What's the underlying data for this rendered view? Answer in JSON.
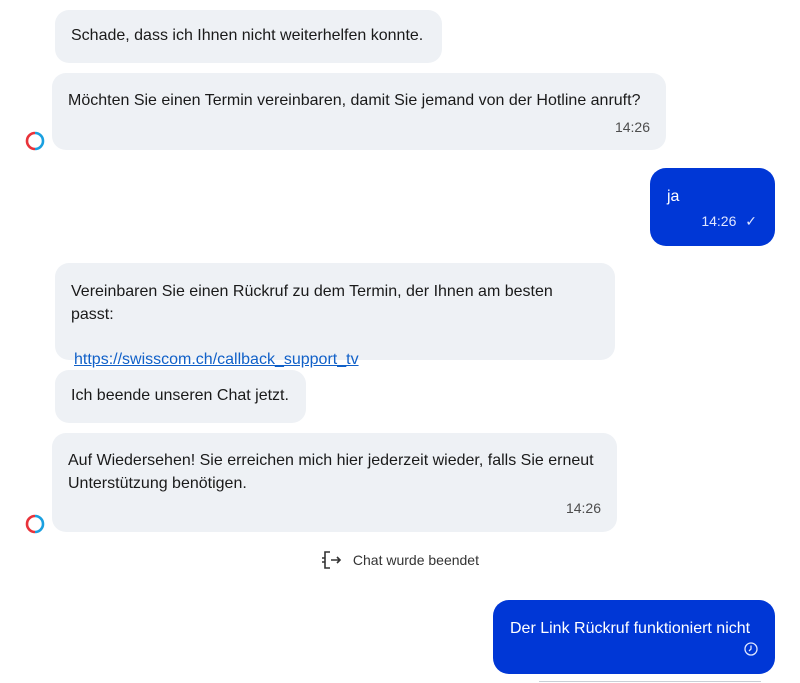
{
  "messages": {
    "m1": {
      "text": "Schade, dass ich Ihnen nicht weiterhelfen konnte."
    },
    "m2": {
      "text": "Möchten Sie einen Termin vereinbaren, damit Sie jemand von der Hotline anruft?",
      "time": "14:26"
    },
    "m3": {
      "text": "ja",
      "time": "14:26",
      "status_icon": "check-icon"
    },
    "m4": {
      "text": "Vereinbaren Sie einen Rückruf zu dem Termin, der Ihnen am besten passt:",
      "link": "https://swisscom.ch/callback_support_tv"
    },
    "m5": {
      "text": "Ich beende unseren Chat jetzt."
    },
    "m6": {
      "text_line1": "Auf Wiedersehen! Sie erreichen mich hier jederzeit wieder, falls Sie erneut",
      "text_line2": "Unterstützung benötigen.",
      "time": "14:26"
    },
    "m7": {
      "text": "Der Link Rückruf funktioniert nicht",
      "status_icon": "clock-icon"
    }
  },
  "system": {
    "chat_ended": "Chat wurde beendet",
    "icon": "exit-icon"
  },
  "colors": {
    "bot_bubble": "#eef1f5",
    "user_bubble": "#0037d6",
    "link": "#1060c8",
    "avatar_red": "#e8333a",
    "avatar_blue": "#1aa0e0"
  }
}
